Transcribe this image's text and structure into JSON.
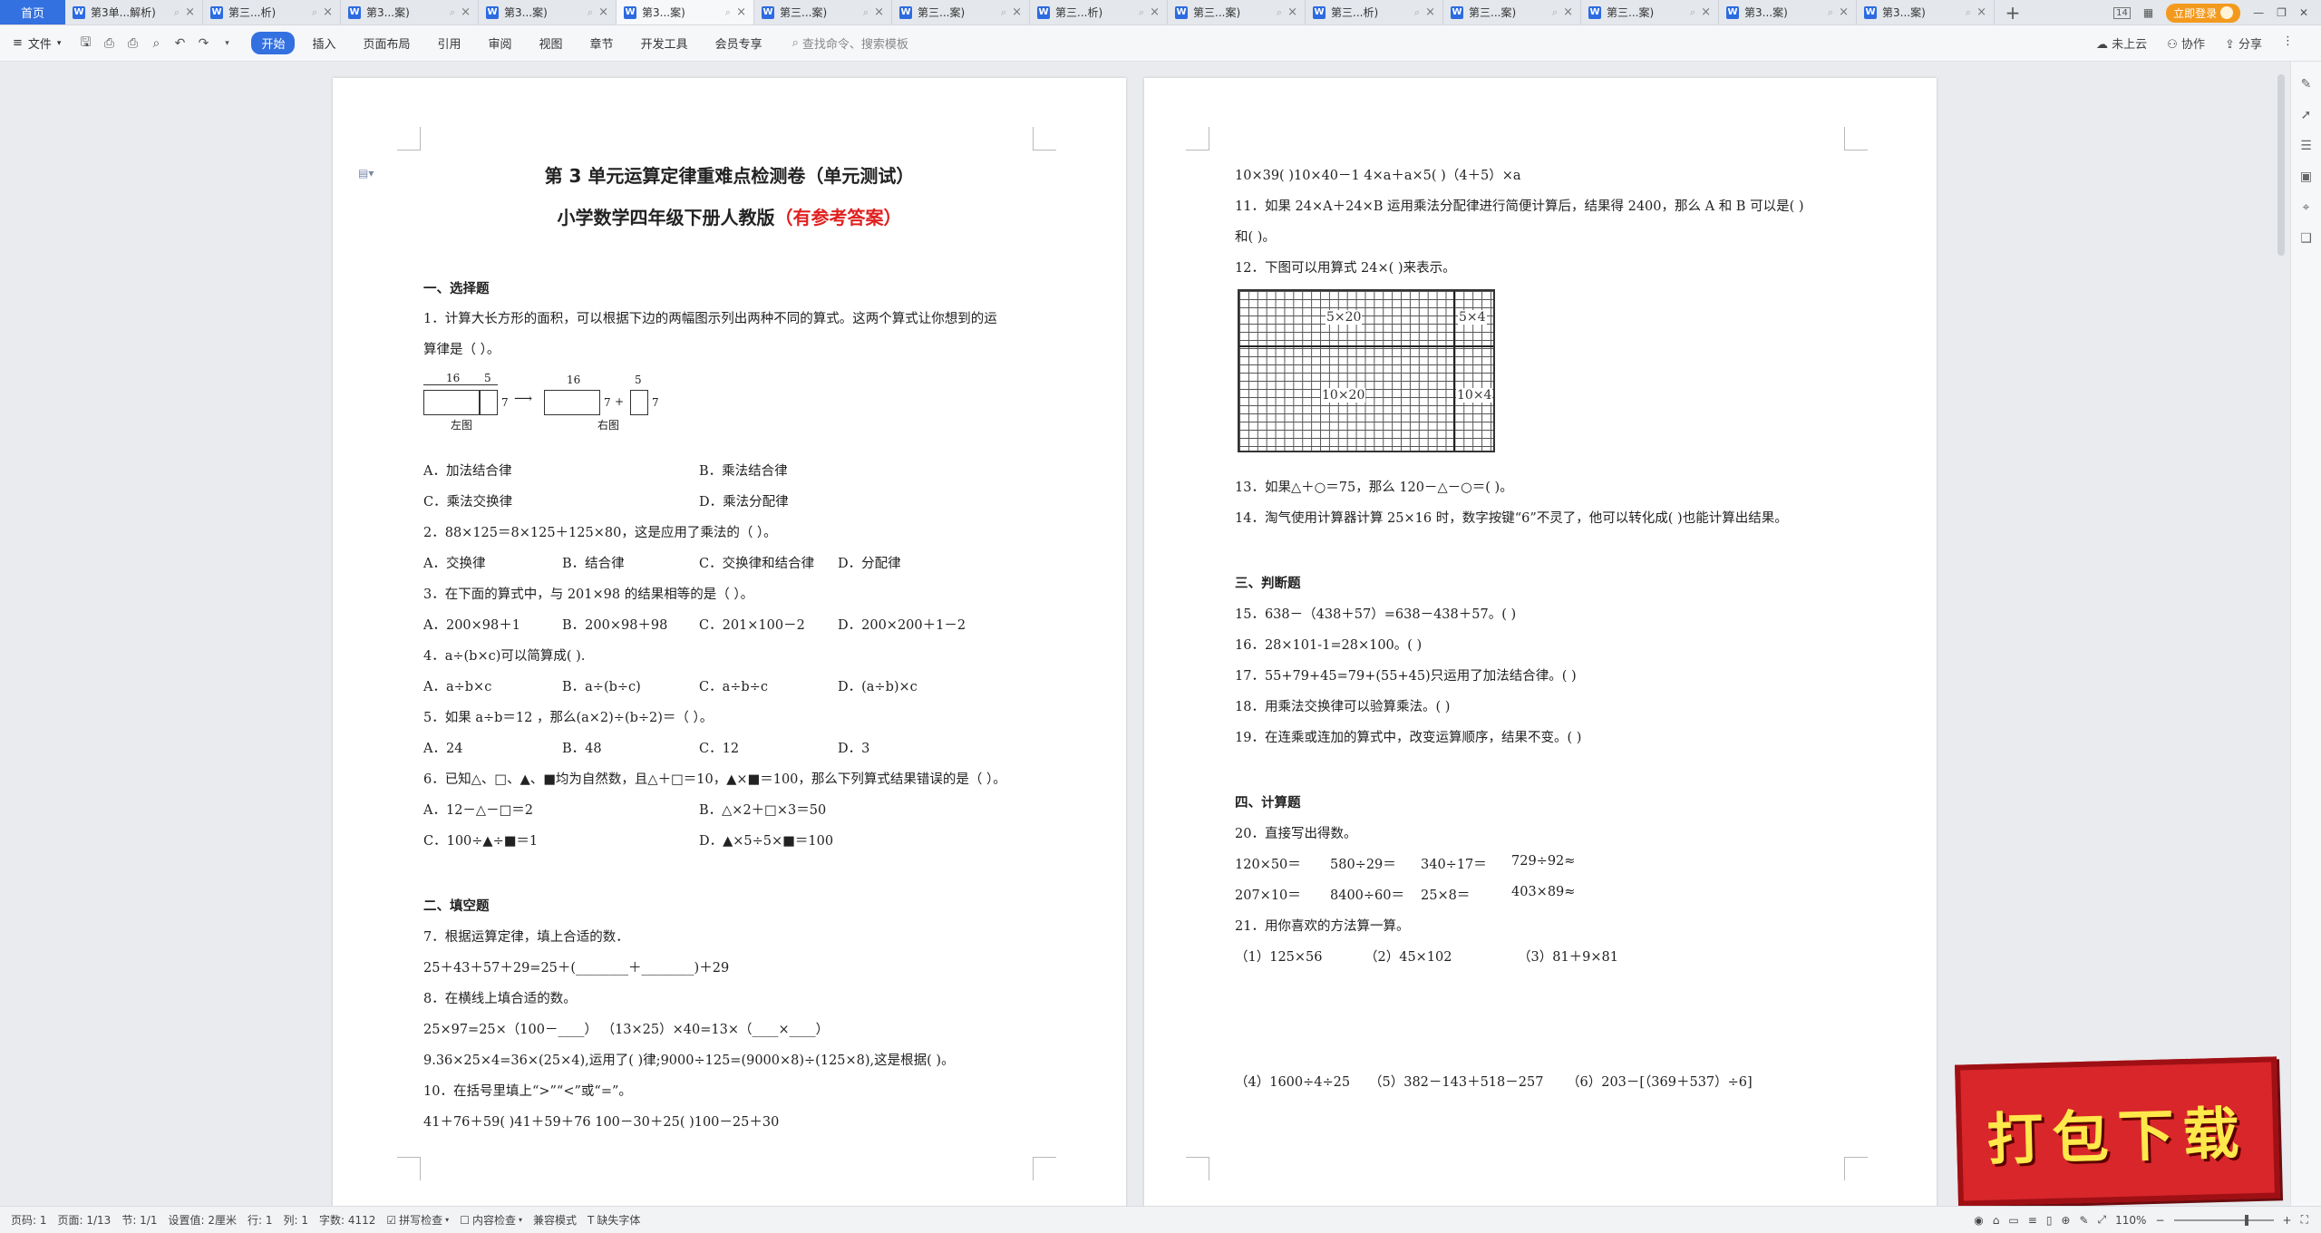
{
  "tabbar": {
    "home": "首页",
    "tabs": [
      {
        "label": "第3单...解析)"
      },
      {
        "label": "第三...析)"
      },
      {
        "label": "第3...案)"
      },
      {
        "label": "第3...案)"
      },
      {
        "label": "第3...案)",
        "active": true
      },
      {
        "label": "第三...案)"
      },
      {
        "label": "第三...案)"
      },
      {
        "label": "第三...析)"
      },
      {
        "label": "第三...案)"
      },
      {
        "label": "第三...析)"
      },
      {
        "label": "第三...案)"
      },
      {
        "label": "第三...案)"
      },
      {
        "label": "第3...案)"
      },
      {
        "label": "第3...案)"
      }
    ],
    "add": "+",
    "badge": "14",
    "login": "立即登录"
  },
  "toolbar": {
    "file": "文件",
    "tabs": [
      "开始",
      "插入",
      "页面布局",
      "引用",
      "审阅",
      "视图",
      "章节",
      "开发工具",
      "会员专享"
    ],
    "search_placeholder": "查找命令、搜索模板",
    "upload": "未上云",
    "collab": "协作",
    "share": "分享"
  },
  "page1": {
    "title1": "第 3 单元运算定律重难点检测卷（单元测试）",
    "title2": "小学数学四年级下册人教版",
    "title2_red": "（有参考答案）",
    "sec1": "一、选择题",
    "q1a": "1．计算大长方形的面积，可以根据下边的两幅图示列出两种不同的算式。这两个算式让你想到的运",
    "q1b": "算律是（    ）。",
    "diagram": {
      "n16": "16",
      "n5": "5",
      "n7": "7",
      "left": "左图",
      "right": "右图",
      "plus": "+"
    },
    "q1opts": [
      "A．加法结合律",
      "B．乘法结合律",
      "C．乘法交换律",
      "D．乘法分配律"
    ],
    "q2": "2．88×125＝8×125＋125×80，这是应用了乘法的（      ）。",
    "q2opts": [
      "A．交换律",
      "B．结合律",
      "C．交换律和结合律",
      "D．分配律"
    ],
    "q3": "3．在下面的算式中，与 201×98 的结果相等的是（    ）。",
    "q3opts": [
      "A．200×98＋1",
      "B．200×98＋98",
      "C．201×100－2",
      "D．200×200＋1－2"
    ],
    "q4": "4．a÷(b×c)可以简算成(      ).",
    "q4opts": [
      "A．a÷b×c",
      "B．a÷(b÷c)",
      "C．a÷b÷c",
      "D．(a÷b)×c"
    ],
    "q5": "5．如果 a÷b＝12 ，那么(a×2)÷(b÷2)＝（    ）。",
    "q5opts": [
      "A．24",
      "B．48",
      "C．12",
      "D．3"
    ],
    "q6": "6．已知△、□、▲、■均为自然数，且△＋□＝10，▲×■＝100，那么下列算式结果错误的是（    ）。",
    "q6opts": [
      "A．12－△－□＝2",
      "B．△×2＋□×3＝50",
      "C．100÷▲÷■＝1",
      "D．▲×5÷5×■＝100"
    ],
    "sec2": "二、填空题",
    "q7": "7．根据运算定律，填上合适的数．",
    "q7b": "25＋43＋57＋29=25＋(________＋________)＋29",
    "q8": "8．在横线上填合适的数。",
    "q8b": "25×97=25×（100－____）          （13×25）×40=13×（____×____）",
    "q9": "9.36×25×4=36×(25×4),运用了(            )律;9000÷125=(9000×8)÷(125×8),这是根据(            )。",
    "q10": "10．在括号里填上“>”“<”或“=”。",
    "q10b": "41＋76＋59(            )41＋59＋76   100－30＋25(            )100－25＋30"
  },
  "page2": {
    "l1": "10×39(            )10×40－1    4×a＋a×5(            )（4＋5）×a",
    "q11a": "11．如果 24×A＋24×B 运用乘法分配律进行简便计算后，结果得 2400，那么 A 和 B 可以是(            )",
    "q11b": "和(            )。",
    "q12": "12．下图可以用算式 24×(          )来表示。",
    "grid": {
      "a": "5×20",
      "b": "5×4",
      "c": "10×20",
      "d": "10×4"
    },
    "q13": "13．如果△＋○＝75，那么 120－△－○＝(            )。",
    "q14": "14．淘气使用计算器计算 25×16 时，数字按键“6”不灵了，他可以转化成(            )也能计算出结果。",
    "sec3": "三、判断题",
    "q15": "15．638－（438＋57）=638－438＋57。(        )",
    "q16": "16．28×101-1=28×100。(         )",
    "q17": "17．55+79+45=79+(55+45)只运用了加法结合律。(         )",
    "q18": "18．用乘法交换律可以验算乘法。(         )",
    "q19": "19．在连乘或连加的算式中，改变运算顺序，结果不变。(         )",
    "sec4": "四、计算题",
    "q20": "20．直接写出得数。",
    "q20r1": [
      "120×50＝",
      "580÷29＝",
      "340÷17＝",
      "729÷92≈"
    ],
    "q20r2": [
      "207×10＝",
      "8400÷60＝",
      "25×8＝",
      "403×89≈"
    ],
    "q21": "21．用你喜欢的方法算一算。",
    "q21r1": [
      "（1）125×56",
      "（2）45×102",
      "（3）81＋9×81"
    ],
    "q21r2": [
      "（4）1600÷4÷25",
      "（5）382－143＋518－257",
      "（6）203－[（369＋537）÷6]"
    ]
  },
  "promo": "打包下载",
  "status": {
    "page": "页码: 1",
    "pages": "页面: 1/13",
    "section": "节: 1/1",
    "setting": "设置值: 2厘米",
    "row": "行: 1",
    "col": "列: 1",
    "words": "字数: 4112",
    "spell": "拼写检查",
    "content": "内容检查",
    "compat": "兼容模式",
    "missing_font": "缺失字体",
    "zoom": "110%"
  }
}
